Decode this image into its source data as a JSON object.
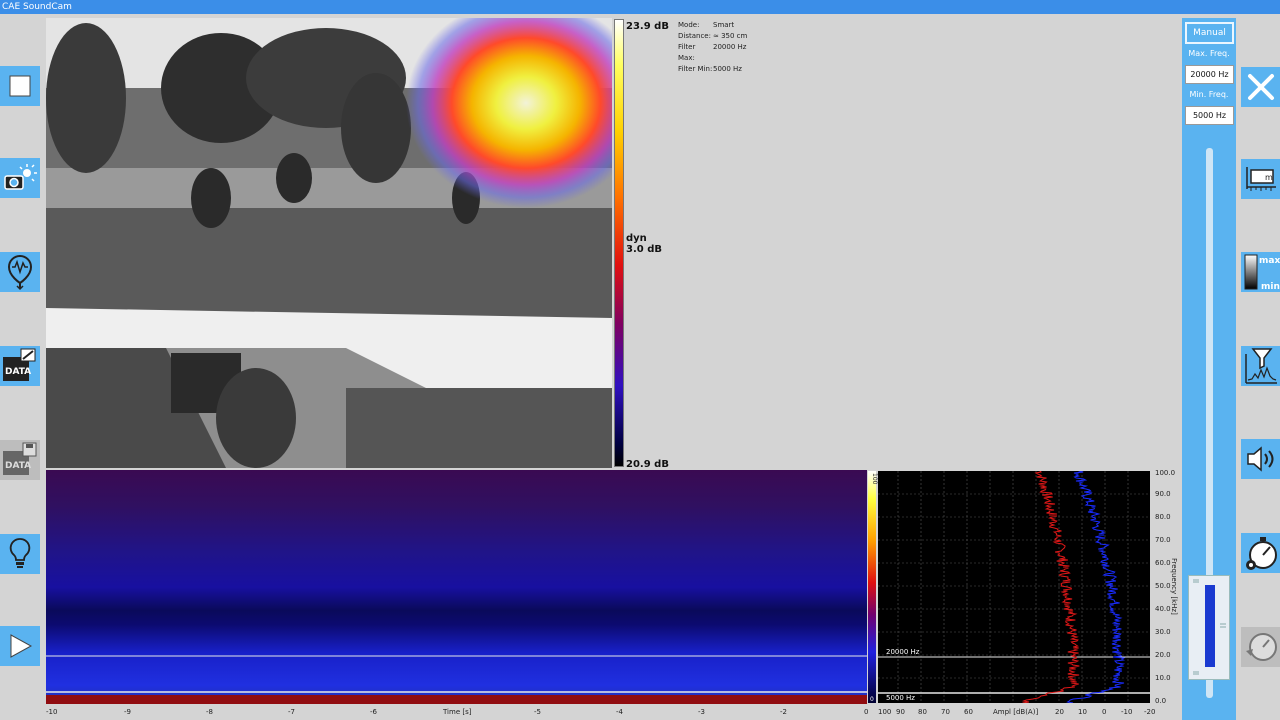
{
  "window": {
    "title": "CAE SoundCam"
  },
  "left_toolbar": [
    {
      "name": "stop-button",
      "icon": "square-icon"
    },
    {
      "name": "snapshot-button",
      "icon": "camera-flash-icon"
    },
    {
      "name": "acoustic-pin-button",
      "icon": "location-pin-icon"
    },
    {
      "name": "data-export-button",
      "icon": "data-export-icon",
      "label": "DATA"
    },
    {
      "name": "data-save-button",
      "icon": "data-save-icon",
      "label": "DATA"
    },
    {
      "name": "light-button",
      "icon": "lightbulb-icon"
    },
    {
      "name": "play-button",
      "icon": "play-icon"
    }
  ],
  "colorbar": {
    "max": "23.9 dB",
    "dyn_label": "dyn",
    "dyn_value": "3.0 dB",
    "min": "20.9 dB"
  },
  "info": {
    "mode_label": "Mode:",
    "mode_value": "Smart",
    "distance_label": "Distance:",
    "distance_value": "≈ 350 cm",
    "filter_max_label": "Filter Max:",
    "filter_max_value": "20000 Hz",
    "filter_min_label": "Filter Min:",
    "filter_min_value": "5000 Hz"
  },
  "spectrogram": {
    "time_label": "Time [s]",
    "time_ticks": [
      "-10",
      "-9",
      "-8",
      "-7",
      "-6",
      "-5",
      "-4",
      "-3",
      "-2",
      "-1",
      "0"
    ],
    "marker_20k": "20000 Hz",
    "marker_5k": "5000 Hz"
  },
  "frequency_plot": {
    "ampl_label": "Ampl [dB(A)]",
    "ampl_ticks": [
      "100",
      "90",
      "80",
      "70",
      "60",
      "20",
      "10",
      "0",
      "-10",
      "-20"
    ],
    "freq_label": "Frequency [kHz]",
    "freq_ticks": [
      "100.0",
      "90.0",
      "80.0",
      "70.0",
      "60.0",
      "50.0",
      "40.0",
      "30.0",
      "20.0",
      "10.0",
      "0.0"
    ],
    "colorbar_top": "100",
    "colorbar_bottom": "0",
    "colors": {
      "series_a": "#e01818",
      "series_b": "#1a2cff"
    }
  },
  "right_panel": {
    "mode_button": "Manual",
    "max_freq_label": "Max. Freq.",
    "max_freq_value": "20000 Hz",
    "min_freq_label": "Min. Freq.",
    "min_freq_value": "5000 Hz"
  },
  "right_toolbar": [
    {
      "name": "close-button",
      "icon": "close-x-icon"
    },
    {
      "name": "distance-measure-button",
      "icon": "distance-ruler-icon",
      "label": "m"
    },
    {
      "name": "dynamic-range-button",
      "icon": "max-min-icon",
      "max_label": "max",
      "min_label": "min"
    },
    {
      "name": "filter-spectrum-button",
      "icon": "filter-funnel-icon"
    },
    {
      "name": "audio-button",
      "icon": "speaker-icon"
    },
    {
      "name": "timer-settings-button",
      "icon": "stopwatch-gear-icon"
    },
    {
      "name": "history-button",
      "icon": "clock-back-icon"
    }
  ]
}
